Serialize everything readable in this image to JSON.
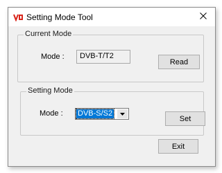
{
  "window": {
    "title": "Setting Mode Tool"
  },
  "current_mode": {
    "legend": "Current Mode",
    "mode_label": "Mode :",
    "mode_value": "DVB-T/T2",
    "read_button": "Read"
  },
  "setting_mode": {
    "legend": "Setting Mode",
    "mode_label": "Mode :",
    "selected_value": "DVB-S/S2",
    "set_button": "Set"
  },
  "exit_button": "Exit",
  "icons": {
    "app": "app-logo-icon",
    "close": "close-icon",
    "dropdown": "chevron-down-icon"
  },
  "colors": {
    "selection": "#0078d7",
    "app_icon_red": "#d9261c"
  }
}
